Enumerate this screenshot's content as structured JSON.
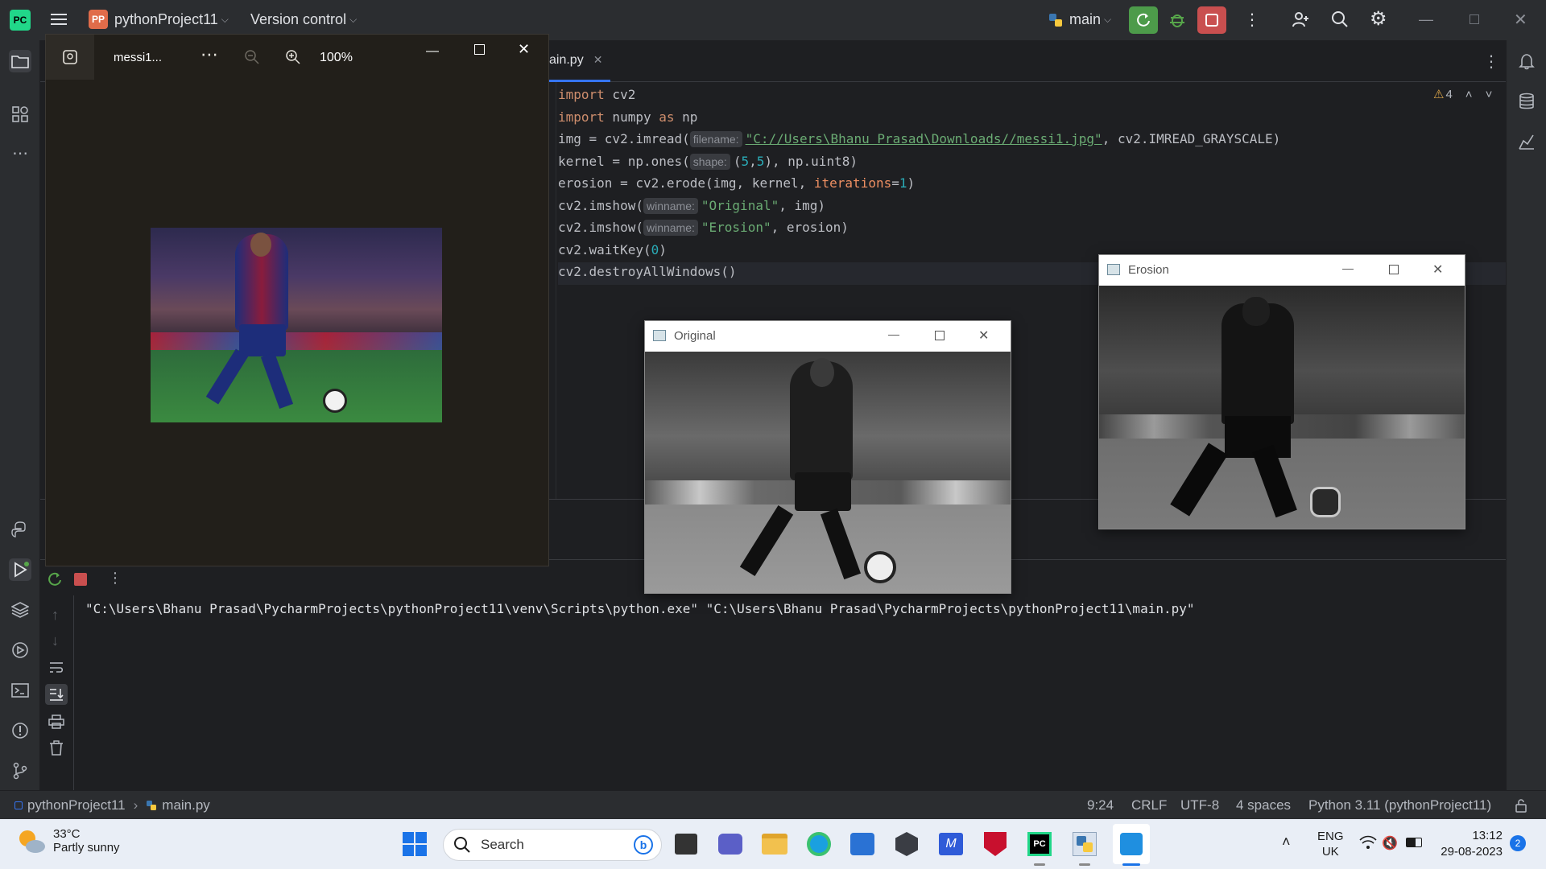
{
  "titlebar": {
    "logo": "PC",
    "project_badge": "PP",
    "project_name": "pythonProject11",
    "vcs_label": "Version control",
    "branch": "main"
  },
  "editor": {
    "tab_label": "ain.py",
    "warning_count": "4",
    "lines": {
      "l1_a": "import",
      "l1_b": " cv2",
      "l2_a": "import",
      "l2_b": " numpy ",
      "l2_c": "as",
      "l2_d": " np",
      "l3_a": "img = cv2.imread(",
      "l3_hint": "filename:",
      "l3_str": "\"C://Users\\Bhanu Prasad\\Downloads//messi1.jpg\"",
      "l3_b": ", cv2.IMREAD_GRAYSCALE)",
      "l4_a": "kernel = np.ones(",
      "l4_hint": "shape:",
      "l4_b": "(",
      "l4_n1": "5",
      "l4_c": ",",
      "l4_n2": "5",
      "l4_d": "), np.uint8)",
      "l5_a": "erosion = cv2.erode(img, kernel, ",
      "l5_param": "iterations",
      "l5_b": "=",
      "l5_num": "1",
      "l5_c": ")",
      "l6_a": "cv2.imshow(",
      "l6_hint": "winname:",
      "l6_str": "\"Original\"",
      "l6_b": ", img)",
      "l7_a": "cv2.imshow(",
      "l7_hint": "winname:",
      "l7_str": "\"Erosion\"",
      "l7_b": ", erosion)",
      "l8_a": "cv2.waitKey(",
      "l8_num": "0",
      "l8_b": ")",
      "l9": "cv2.destroyAllWindows()"
    }
  },
  "run": {
    "command": "\"C:\\Users\\Bhanu Prasad\\PycharmProjects\\pythonProject11\\venv\\Scripts\\python.exe\" \"C:\\Users\\Bhanu Prasad\\PycharmProjects\\pythonProject11\\main.py\""
  },
  "photos": {
    "filename": "messi1...",
    "zoom": "100%"
  },
  "cv_original": {
    "title": "Original"
  },
  "cv_erosion": {
    "title": "Erosion"
  },
  "statusbar": {
    "project": "pythonProject11",
    "file": "main.py",
    "position": "9:24",
    "line_sep": "CRLF",
    "encoding": "UTF-8",
    "indent": "4 spaces",
    "interpreter": "Python 3.11 (pythonProject11)"
  },
  "taskbar": {
    "weather_temp": "33°C",
    "weather_desc": "Partly sunny",
    "search_placeholder": "Search",
    "lang_top": "ENG",
    "lang_bottom": "UK",
    "time": "13:12",
    "date": "29-08-2023",
    "notif_count": "2"
  },
  "colors": {
    "run_green": "#4d9b4a",
    "stop_red": "#c94f4f",
    "accent_blue": "#3574f0"
  }
}
